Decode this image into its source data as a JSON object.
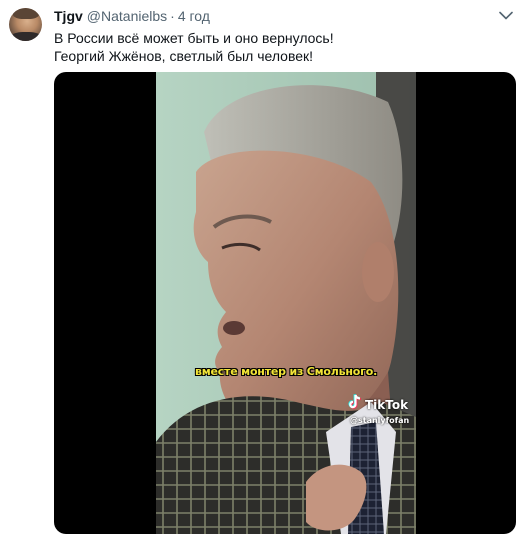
{
  "tweet": {
    "display_name": "Tjgv",
    "handle": "@Natanielbs",
    "separator": "·",
    "time": "4 год",
    "text_lines": [
      "В России всё может быть и оно вернулось!",
      "Георгий Жжёнов, светлый был человек!"
    ],
    "more_icon": "chevron-down-icon"
  },
  "media": {
    "subtitle": "вместе монтер из Смольного.",
    "watermark_brand": "TikTok",
    "watermark_user": "@stanlyfofan",
    "colors": {
      "letterbox": "#000000",
      "background_wall": "#a6c7b4",
      "subtitle": "#f2e437"
    }
  }
}
